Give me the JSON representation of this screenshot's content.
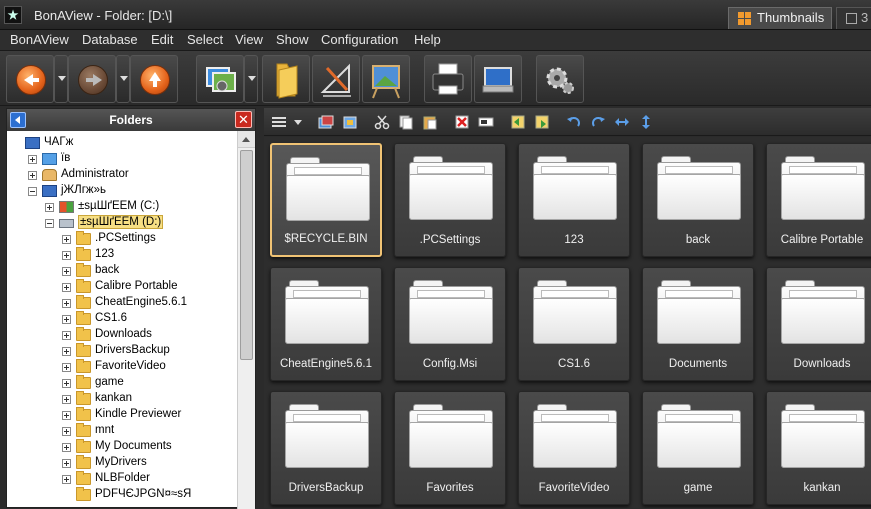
{
  "window": {
    "title": "BonAView - Folder: [D:\\]",
    "logo_glyph": "★",
    "tabs": [
      {
        "label": "Thumbnails",
        "icon": "grid-icon",
        "active": true
      },
      {
        "label": "3",
        "icon": "window-icon",
        "active": false
      }
    ]
  },
  "menu": [
    "BonAView",
    "Database",
    "Edit",
    "Select",
    "View",
    "Show",
    "Configuration",
    "Help"
  ],
  "toolbar": {
    "buttons": [
      "back",
      "forward",
      "up",
      "photos",
      "folder",
      "edit",
      "painting",
      "print",
      "scanner",
      "settings"
    ]
  },
  "folders_panel": {
    "title": "Folders",
    "close_glyph": "✕",
    "tree": [
      {
        "label": "ЧАГж",
        "depth": 0,
        "icon": "computer-icon",
        "expander": "none"
      },
      {
        "label": "ïв",
        "depth": 1,
        "icon": "network-icon",
        "expander": "plus"
      },
      {
        "label": "Administrator",
        "depth": 1,
        "icon": "user-icon",
        "expander": "plus"
      },
      {
        "label": "jЖЛгж»ь",
        "depth": 1,
        "icon": "computer-icon",
        "expander": "minus"
      },
      {
        "label": "±ѕµШґЕЕМ (C:)",
        "depth": 2,
        "icon": "windows-drive-icon",
        "expander": "plus"
      },
      {
        "label": "±ѕµШґЕЕМ (D:)",
        "depth": 2,
        "icon": "drive-icon",
        "expander": "minus",
        "selected": true
      },
      {
        "label": ".PCSettings",
        "depth": 3,
        "icon": "folder-icon",
        "expander": "plus"
      },
      {
        "label": "123",
        "depth": 3,
        "icon": "folder-icon",
        "expander": "plus"
      },
      {
        "label": "back",
        "depth": 3,
        "icon": "folder-icon",
        "expander": "plus"
      },
      {
        "label": "Calibre Portable",
        "depth": 3,
        "icon": "folder-icon",
        "expander": "plus"
      },
      {
        "label": "CheatEngine5.6.1",
        "depth": 3,
        "icon": "folder-icon",
        "expander": "plus"
      },
      {
        "label": "CS1.6",
        "depth": 3,
        "icon": "folder-icon",
        "expander": "plus"
      },
      {
        "label": "Downloads",
        "depth": 3,
        "icon": "folder-icon",
        "expander": "plus"
      },
      {
        "label": "DriversBackup",
        "depth": 3,
        "icon": "folder-icon",
        "expander": "plus"
      },
      {
        "label": "FavoriteVideo",
        "depth": 3,
        "icon": "folder-icon",
        "expander": "plus"
      },
      {
        "label": "game",
        "depth": 3,
        "icon": "folder-icon",
        "expander": "plus"
      },
      {
        "label": "kankan",
        "depth": 3,
        "icon": "folder-icon",
        "expander": "plus"
      },
      {
        "label": "Kindle Previewer",
        "depth": 3,
        "icon": "folder-icon",
        "expander": "plus"
      },
      {
        "label": "mnt",
        "depth": 3,
        "icon": "folder-icon",
        "expander": "plus"
      },
      {
        "label": "My Documents",
        "depth": 3,
        "icon": "folder-icon",
        "expander": "plus"
      },
      {
        "label": "MyDrivers",
        "depth": 3,
        "icon": "folder-icon",
        "expander": "plus"
      },
      {
        "label": "NLBFolder",
        "depth": 3,
        "icon": "folder-icon",
        "expander": "plus"
      },
      {
        "label": "PDFЧЄJPGN¤≈sЯ",
        "depth": 3,
        "icon": "folder-icon",
        "expander": "none"
      }
    ]
  },
  "content_toolbar": {
    "buttons": [
      "view-mode-icon",
      "view-dropdown-icon",
      "open-icon",
      "browse-icon",
      "cut-icon",
      "copy-icon",
      "paste-icon",
      "delete-icon",
      "rename-icon",
      "import-icon",
      "export-icon",
      "undo-icon",
      "redo-icon",
      "flip-horizontal-icon",
      "flip-vertical-icon"
    ]
  },
  "thumbnails": [
    {
      "label": "$RECYCLE.BIN",
      "selected": true
    },
    {
      "label": ".PCSettings"
    },
    {
      "label": "123"
    },
    {
      "label": "back"
    },
    {
      "label": "Calibre Portable"
    },
    {
      "label": "CheatEngine5.6.1"
    },
    {
      "label": "Config.Msi"
    },
    {
      "label": "CS1.6"
    },
    {
      "label": "Documents"
    },
    {
      "label": "Downloads"
    },
    {
      "label": "DriversBackup"
    },
    {
      "label": "Favorites"
    },
    {
      "label": "FavoriteVideo"
    },
    {
      "label": "game"
    },
    {
      "label": "kankan"
    }
  ],
  "colors": {
    "selection_border": "#f0c374",
    "tree_selection": "#f7df84",
    "accent_orange": "#e4621a"
  }
}
